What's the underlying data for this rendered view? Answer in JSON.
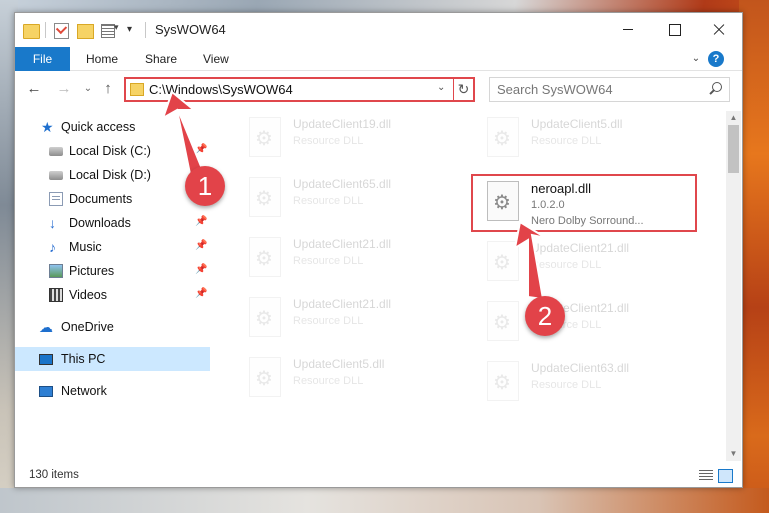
{
  "window": {
    "title": "SysWOW64",
    "quick_access_dropdown": "▾"
  },
  "ribbon": {
    "file_tab": "File",
    "tabs": [
      "Home",
      "Share",
      "View"
    ],
    "expand_glyph": "⌄",
    "help_glyph": "?"
  },
  "address": {
    "path": "C:\\Windows\\SysWOW64",
    "dropdown_glyph": "⌄",
    "refresh_glyph": "↻"
  },
  "nav_glyphs": {
    "back": "←",
    "forward": "→",
    "recent": "⌄",
    "up": "↑"
  },
  "search": {
    "placeholder": "Search SysWOW64"
  },
  "sidebar": {
    "items": [
      {
        "label": "Quick access",
        "icon": "star-icon",
        "pinned": false
      },
      {
        "label": "Local Disk (C:)",
        "icon": "disk-icon",
        "pinned": true
      },
      {
        "label": "Local Disk (D:)",
        "icon": "disk-icon",
        "pinned": false
      },
      {
        "label": "Documents",
        "icon": "documents-icon",
        "pinned": true
      },
      {
        "label": "Downloads",
        "icon": "download-icon",
        "pinned": true
      },
      {
        "label": "Music",
        "icon": "music-icon",
        "pinned": true
      },
      {
        "label": "Pictures",
        "icon": "pictures-icon",
        "pinned": true
      },
      {
        "label": "Videos",
        "icon": "videos-icon",
        "pinned": true
      },
      {
        "label": "OneDrive",
        "icon": "cloud-icon",
        "pinned": false
      },
      {
        "label": "This PC",
        "icon": "computer-icon",
        "pinned": false,
        "selected": true
      },
      {
        "label": "Network",
        "icon": "network-icon",
        "pinned": false
      }
    ],
    "pin_glyph": "📌"
  },
  "files": {
    "left_column": [
      {
        "name": "UpdateClient19.dll",
        "type": "Resource DLL"
      },
      {
        "name": "UpdateClient65.dll",
        "type": "Resource DLL"
      },
      {
        "name": "UpdateClient21.dll",
        "type": "Resource DLL"
      },
      {
        "name": "UpdateClient21.dll",
        "type": "Resource DLL"
      },
      {
        "name": "UpdateClient5.dll",
        "type": "Resource DLL"
      }
    ],
    "right_column": [
      {
        "name": "UpdateClient5.dll",
        "type": "Resource DLL"
      },
      {
        "name": "neroapl.dll",
        "version": "1.0.2.0",
        "description": "Nero Dolby Sorround...",
        "highlighted": true
      },
      {
        "name": "UpdateClient21.dll",
        "type": "Resource DLL"
      },
      {
        "name": "UpdateClient21.dll",
        "type": "Resource DLL"
      },
      {
        "name": "UpdateClient63.dll",
        "type": "Resource DLL"
      }
    ]
  },
  "scroll_glyphs": {
    "up": "▲",
    "down": "▼"
  },
  "status": {
    "item_count": "130 items"
  },
  "annotations": {
    "step1": "1",
    "step2": "2",
    "color": "#e24349"
  },
  "colors": {
    "accent": "#1979ca",
    "highlight_border": "#e0474c",
    "selected_nav": "#cce8ff"
  }
}
